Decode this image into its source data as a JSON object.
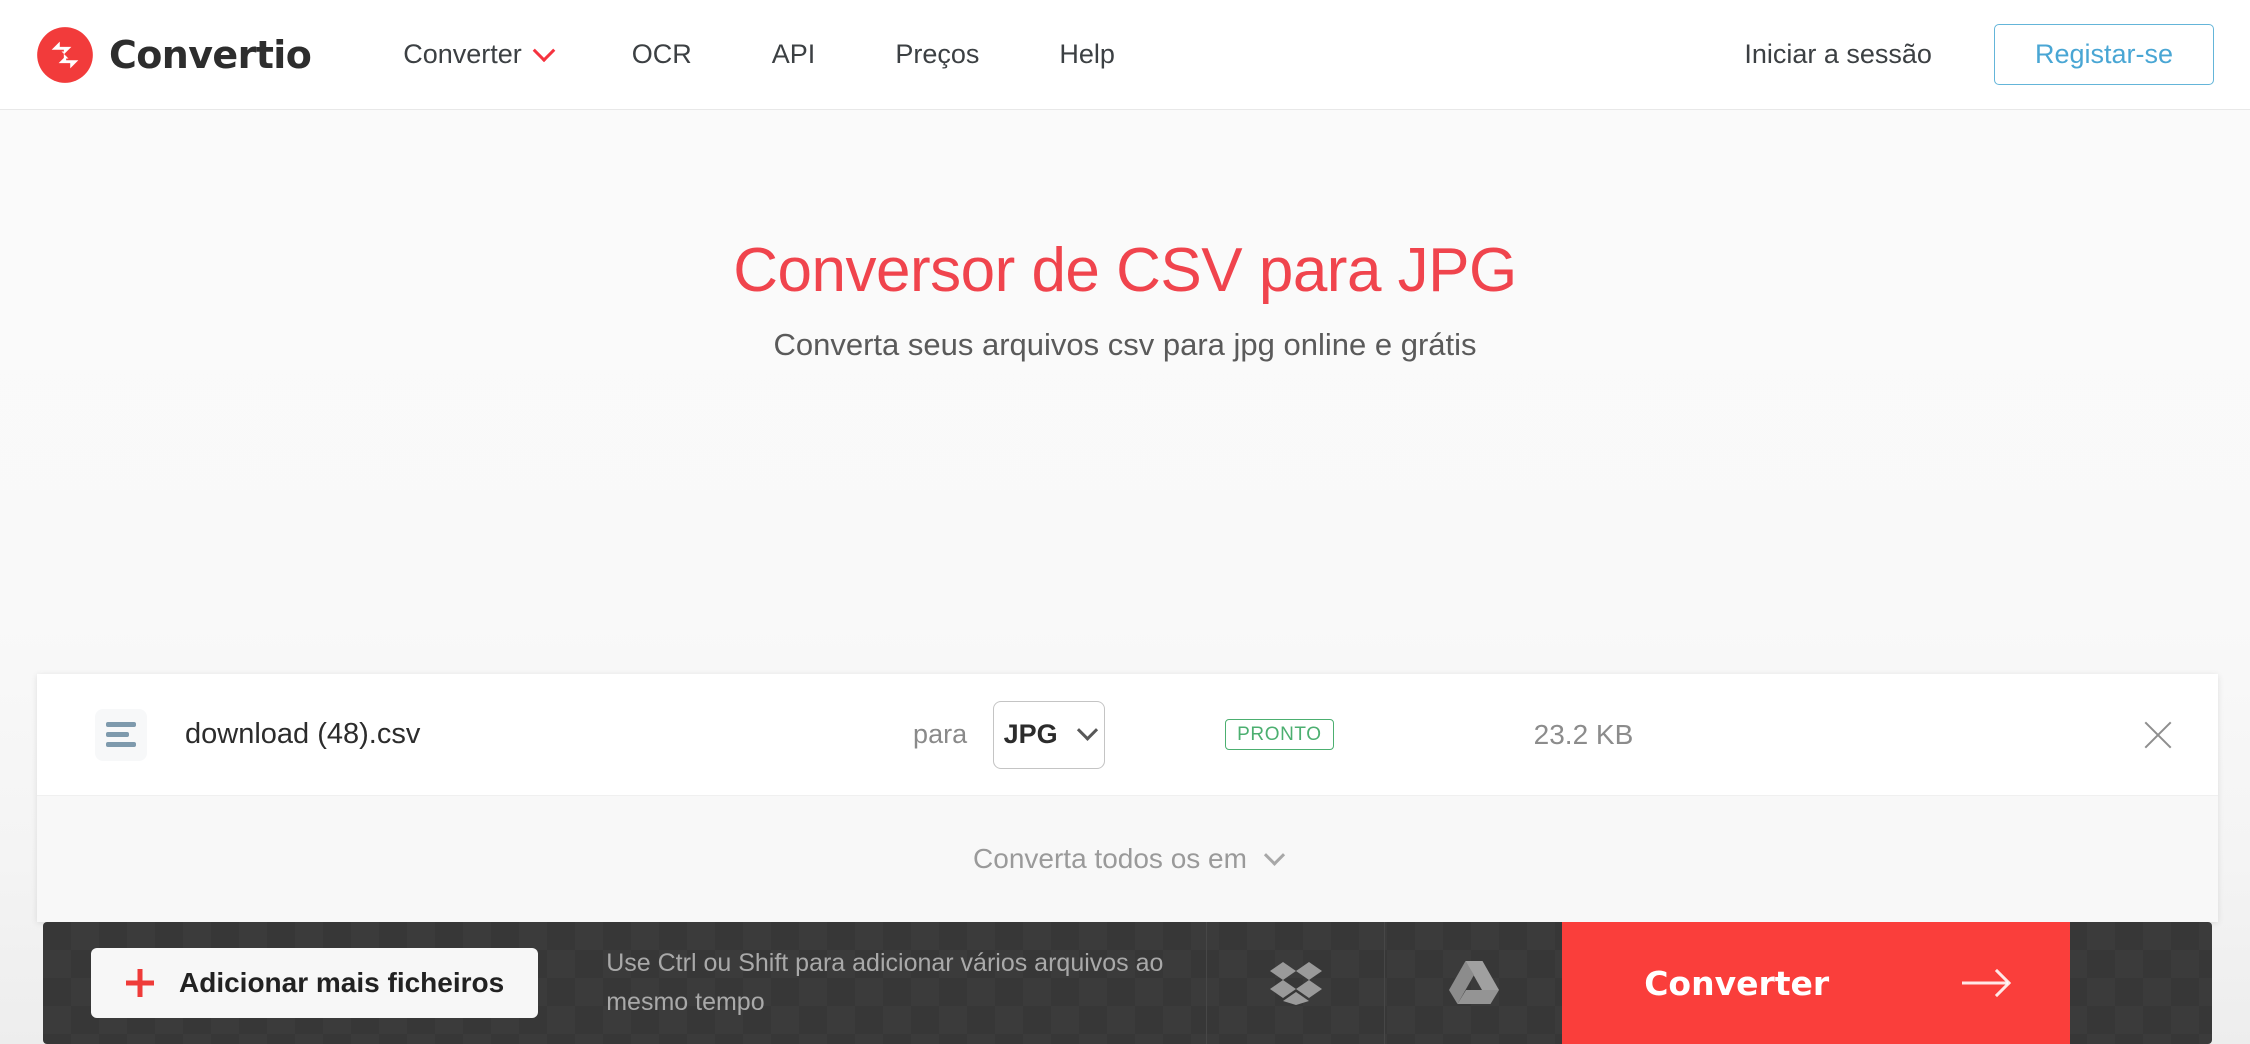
{
  "header": {
    "brand_name": "Convertio",
    "nav": [
      {
        "label": "Converter",
        "has_dropdown": true
      },
      {
        "label": "OCR",
        "has_dropdown": false
      },
      {
        "label": "API",
        "has_dropdown": false
      },
      {
        "label": "Preços",
        "has_dropdown": false
      },
      {
        "label": "Help",
        "has_dropdown": false
      }
    ],
    "login_label": "Iniciar a sessão",
    "register_label": "Registar-se"
  },
  "hero": {
    "title": "Conversor de CSV para JPG",
    "subtitle": "Converta seus arquivos csv para jpg online e grátis"
  },
  "converter": {
    "file": {
      "name": "download (48).csv",
      "to_label": "para",
      "target_format": "JPG",
      "status": "PRONTO",
      "size": "23.2 KB"
    },
    "convert_all_label": "Converta todos os em"
  },
  "actionbar": {
    "add_files_label": "Adicionar mais ficheiros",
    "hint": "Use Ctrl ou Shift para adicionar vários arquivos ao mesmo tempo",
    "dropbox_label": "Dropbox",
    "google_drive_label": "Google Drive",
    "convert_label": "Converter"
  },
  "colors": {
    "brand_red": "#f0444d",
    "convert_red": "#fa3e3b",
    "register_blue": "#49a6d4",
    "status_green": "#4caf70",
    "dark_bar": "#373737"
  }
}
